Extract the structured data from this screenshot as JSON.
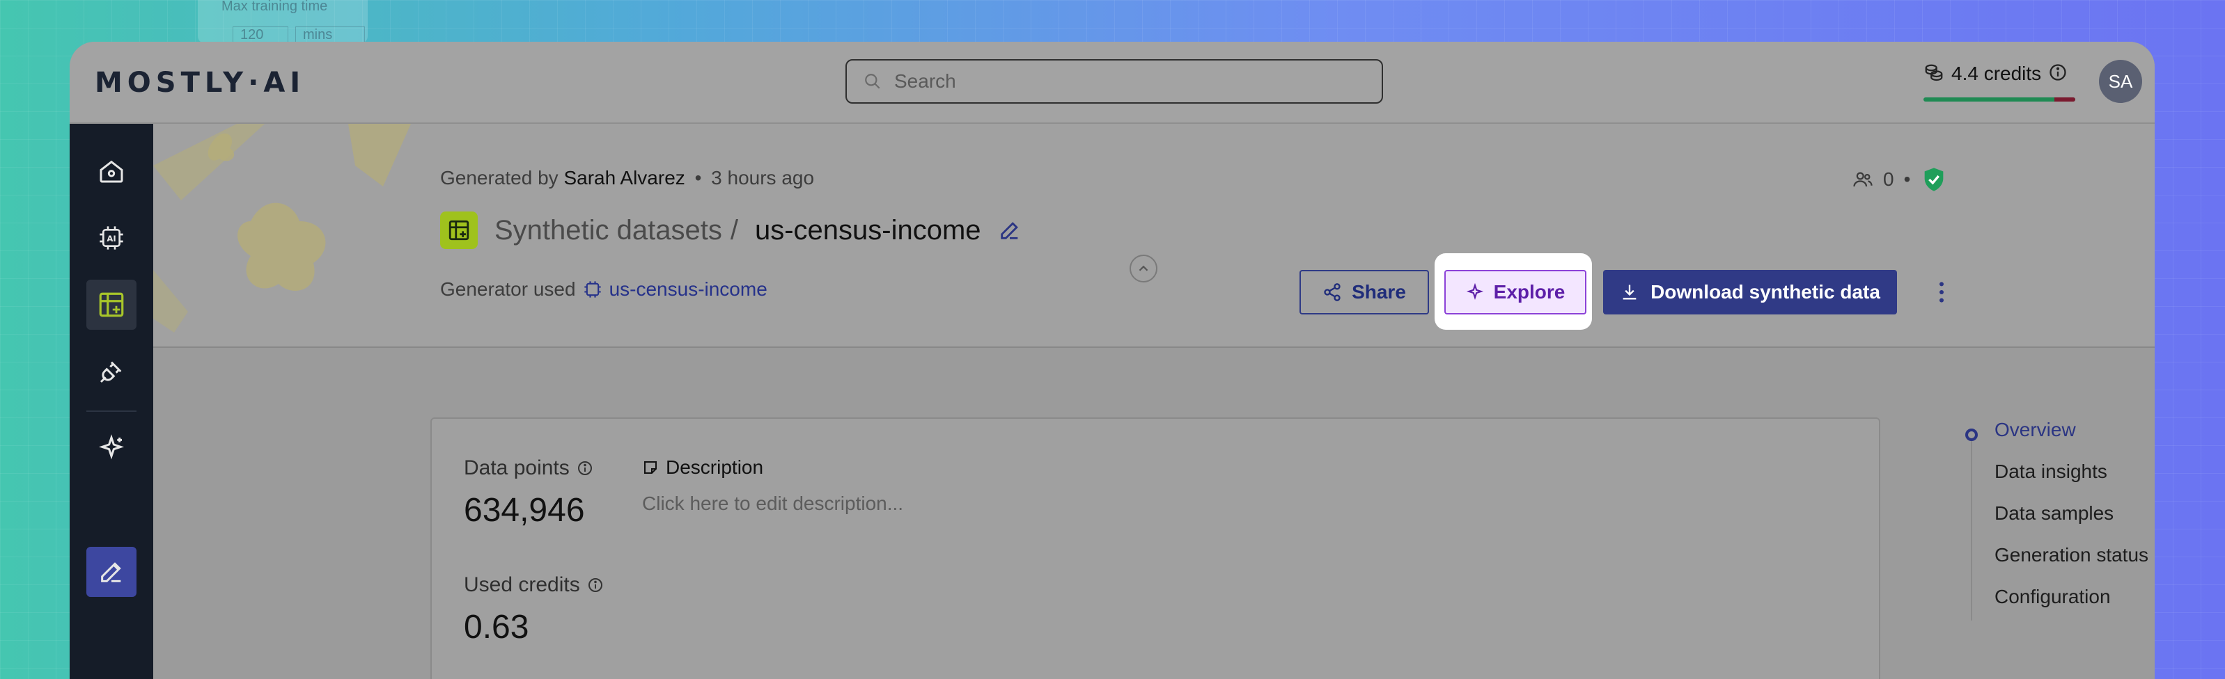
{
  "background": {
    "card_title": "Max training time",
    "card_value": "120",
    "card_unit": "mins"
  },
  "topbar": {
    "logo": "MOSTLY·AI",
    "search_placeholder": "Search",
    "credits": "4.4 credits",
    "avatar_initials": "SA"
  },
  "header": {
    "generated_by_prefix": "Generated by",
    "generated_by_name": "Sarah Alvarez",
    "bullet": "•",
    "time_ago": "3 hours ago",
    "breadcrumb_parent": "Synthetic datasets",
    "breadcrumb_sep": "/",
    "breadcrumb_current": "us-census-income",
    "generator_used_label": "Generator used",
    "generator_used_value": "us-census-income",
    "shared_count": "0",
    "share_label": "Share",
    "explore_label": "Explore",
    "download_label": "Download synthetic data"
  },
  "card": {
    "data_points_label": "Data points",
    "data_points_value": "634,946",
    "used_credits_label": "Used credits",
    "used_credits_value": "0.63",
    "description_title": "Description",
    "description_placeholder": "Click here to edit description..."
  },
  "toc": {
    "items": [
      "Overview",
      "Data insights",
      "Data samples",
      "Generation status",
      "Configuration"
    ],
    "active_index": 0
  },
  "colors": {
    "primary": "#303a86",
    "explore_accent": "#8c42d8",
    "dataset_icon": "#9fc21d",
    "shield": "#1f9e5a"
  }
}
